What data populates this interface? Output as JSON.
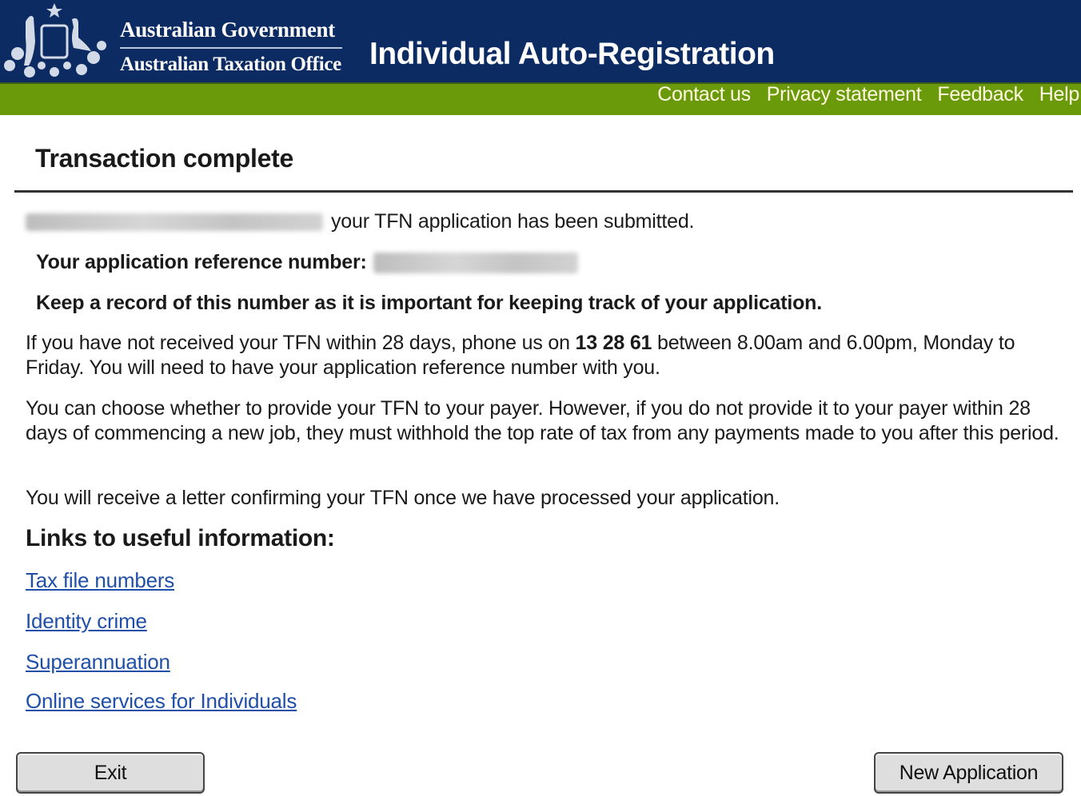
{
  "header": {
    "gov_name": "Australian Government",
    "agency_name": "Australian Taxation Office",
    "app_title": "Individual Auto-Registration",
    "crest_icon": "commonwealth-coat-of-arms"
  },
  "nav": {
    "links": [
      "Contact us",
      "Privacy statement",
      "Feedback",
      "Help"
    ]
  },
  "main": {
    "page_title": "Transaction complete",
    "submitted_text": "your TFN application has been submitted.",
    "ref_label": "Your application reference number:",
    "keep_record": "Keep a record of this number as it is important for keeping track of your application.",
    "para1_a": "If you have not received your TFN within 28 days, phone us on ",
    "para1_phone": "13 28 61",
    "para1_b": " between 8.00am and 6.00pm, Monday to Friday. You will need to have your application reference number with you.",
    "para2": "You can choose whether to provide your TFN to your payer. However, if you do not provide it to your payer within 28 days of commencing a new job, they must withhold the top rate of tax from any payments made to you after this period.",
    "para3": "You will receive a letter confirming your TFN once we have processed your application.",
    "links_heading": "Links to useful information:",
    "links": [
      "Tax file numbers",
      "Identity crime",
      "Superannuation",
      "Online services for Individuals"
    ]
  },
  "buttons": {
    "exit": "Exit",
    "new_application": "New Application"
  }
}
